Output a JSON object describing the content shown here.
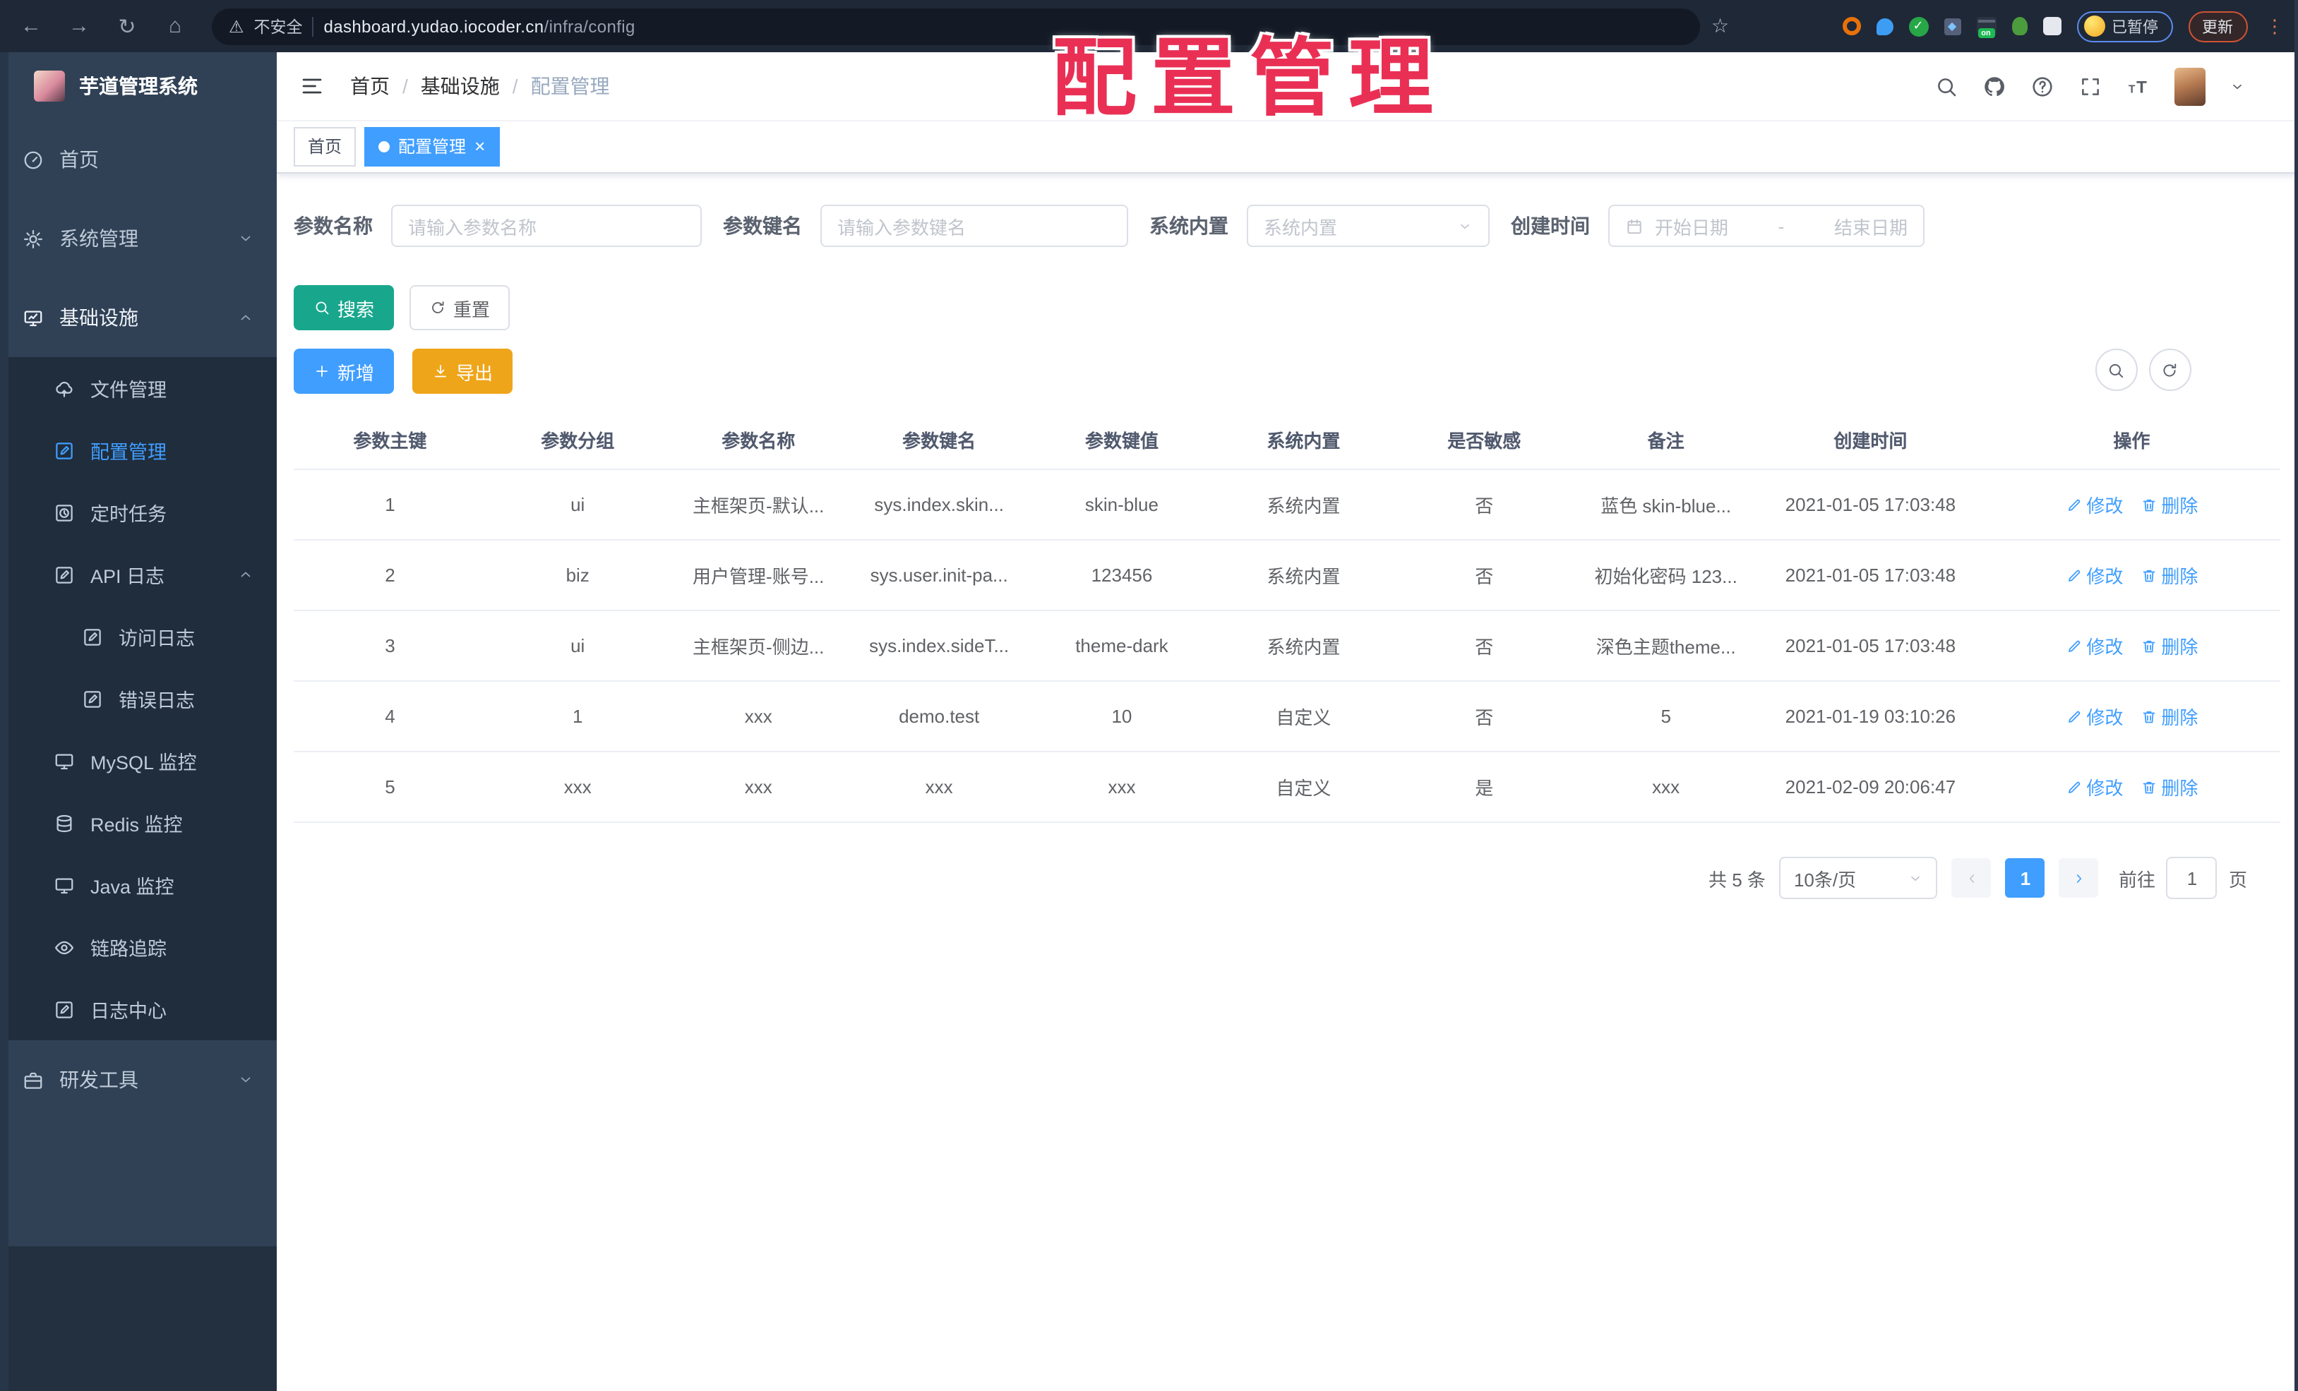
{
  "colors": {
    "primary": "#409EFF",
    "search_teal": "#18a78d",
    "export_amber": "#efa51a",
    "annotation_red": "#ea2f55",
    "sidebar_bg": "#304156",
    "submenu_bg": "#1f2d3d",
    "browser_bar_bg": "#1f2837"
  },
  "annotation": {
    "text": "配置管理"
  },
  "browser": {
    "security_label": "不安全",
    "url_domain": "dashboard.yudao.iocoder.cn",
    "url_path": "/infra/config",
    "ext_on_badge": "on",
    "paused_badge": "已暂停",
    "update_label": "更新"
  },
  "sidebar": {
    "app_title": "芋道管理系统",
    "items": [
      {
        "label": "首页"
      },
      {
        "label": "系统管理"
      },
      {
        "label": "基础设施"
      },
      {
        "label": "文件管理"
      },
      {
        "label": "配置管理"
      },
      {
        "label": "定时任务"
      },
      {
        "label": "API 日志"
      },
      {
        "label": "访问日志"
      },
      {
        "label": "错误日志"
      },
      {
        "label": "MySQL 监控"
      },
      {
        "label": "Redis 监控"
      },
      {
        "label": "Java 监控"
      },
      {
        "label": "链路追踪"
      },
      {
        "label": "日志中心"
      },
      {
        "label": "研发工具"
      }
    ]
  },
  "header": {
    "breadcrumb": {
      "home": "首页",
      "section": "基础设施",
      "current": "配置管理",
      "sep": "/"
    }
  },
  "tabs": {
    "home": "首页",
    "current": "配置管理"
  },
  "filters": {
    "name_label": "参数名称",
    "name_placeholder": "请输入参数名称",
    "key_label": "参数键名",
    "key_placeholder": "请输入参数键名",
    "builtin_label": "系统内置",
    "builtin_placeholder": "系统内置",
    "date_label": "创建时间",
    "date_start": "开始日期",
    "date_sep": "-",
    "date_end": "结束日期",
    "search_label": "搜索",
    "reset_label": "重置",
    "add_label": "新增",
    "export_label": "导出"
  },
  "table": {
    "columns": [
      "参数主键",
      "参数分组",
      "参数名称",
      "参数键名",
      "参数键值",
      "系统内置",
      "是否敏感",
      "备注",
      "创建时间",
      "操作"
    ],
    "rows": [
      {
        "id": "1",
        "group": "ui",
        "name": "主框架页-默认...",
        "key": "sys.index.skin...",
        "value": "skin-blue",
        "builtin": "系统内置",
        "sensitive": "否",
        "remark": "蓝色 skin-blue...",
        "created": "2021-01-05 17:03:48"
      },
      {
        "id": "2",
        "group": "biz",
        "name": "用户管理-账号...",
        "key": "sys.user.init-pa...",
        "value": "123456",
        "builtin": "系统内置",
        "sensitive": "否",
        "remark": "初始化密码 123...",
        "created": "2021-01-05 17:03:48"
      },
      {
        "id": "3",
        "group": "ui",
        "name": "主框架页-侧边...",
        "key": "sys.index.sideT...",
        "value": "theme-dark",
        "builtin": "系统内置",
        "sensitive": "否",
        "remark": "深色主题theme...",
        "created": "2021-01-05 17:03:48"
      },
      {
        "id": "4",
        "group": "1",
        "name": "xxx",
        "key": "demo.test",
        "value": "10",
        "builtin": "自定义",
        "sensitive": "否",
        "remark": "5",
        "created": "2021-01-19 03:10:26"
      },
      {
        "id": "5",
        "group": "xxx",
        "name": "xxx",
        "key": "xxx",
        "value": "xxx",
        "builtin": "自定义",
        "sensitive": "是",
        "remark": "xxx",
        "created": "2021-02-09 20:06:47"
      }
    ],
    "edit_label": "修改",
    "delete_label": "删除"
  },
  "pagination": {
    "total": "共 5 条",
    "page_size": "10条/页",
    "page": "1",
    "goto_label": "前往",
    "goto_value": "1",
    "unit_label": "页"
  }
}
